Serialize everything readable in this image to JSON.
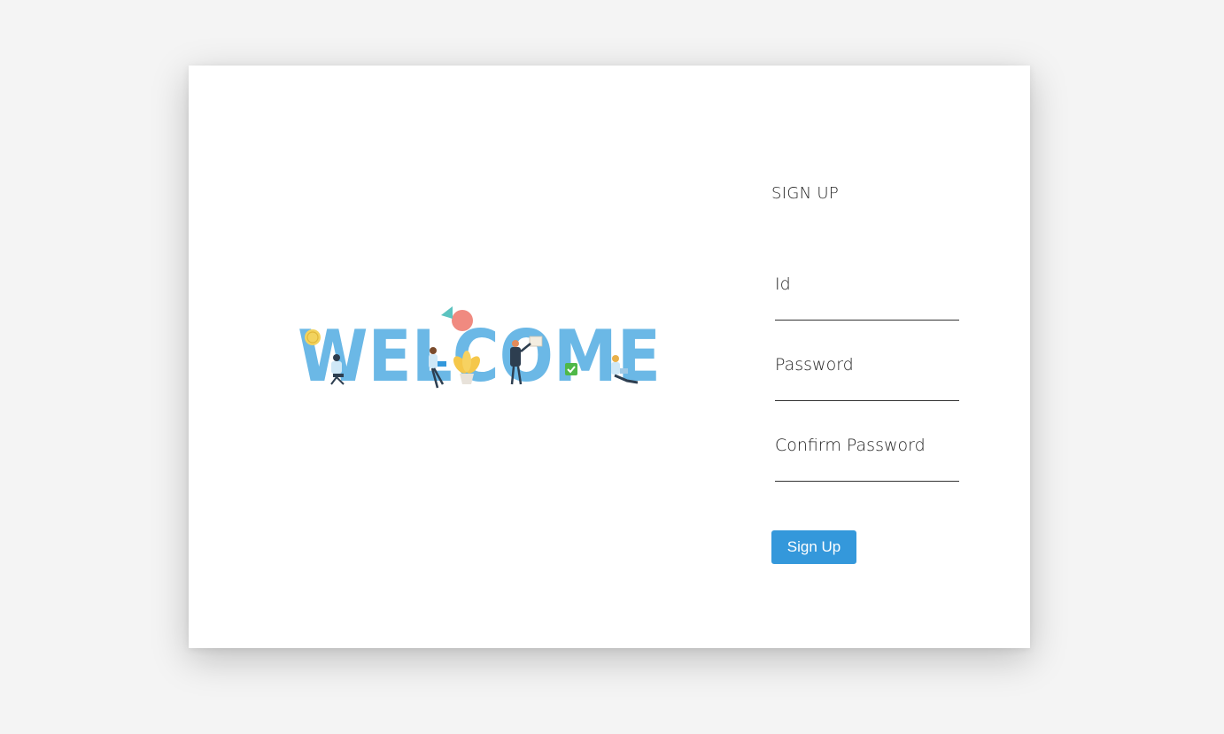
{
  "illustration": {
    "word": "WELCOME",
    "letters": [
      "W",
      "E",
      "L",
      "C",
      "O",
      "M",
      "E"
    ]
  },
  "form": {
    "title": "SIGN UP",
    "fields": [
      {
        "label": "Id",
        "value": ""
      },
      {
        "label": "Password",
        "value": ""
      },
      {
        "label": "Confirm Password",
        "value": ""
      }
    ],
    "submit_label": "Sign Up"
  },
  "colors": {
    "page_bg": "#f4f4f4",
    "card_bg": "#ffffff",
    "letters": "#6bb8e6",
    "button": "#3498db"
  }
}
